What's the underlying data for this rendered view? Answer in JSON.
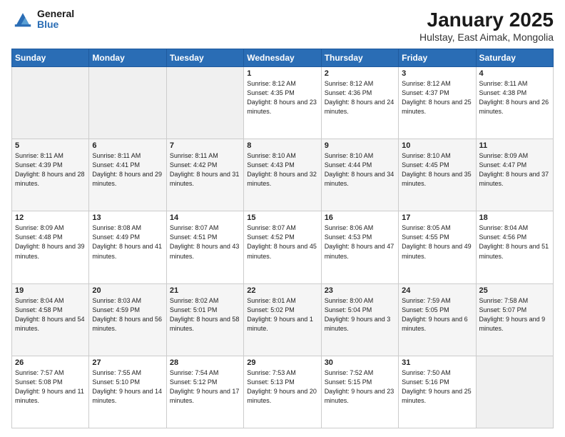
{
  "logo": {
    "general": "General",
    "blue": "Blue"
  },
  "header": {
    "title": "January 2025",
    "subtitle": "Hulstay, East Aimak, Mongolia"
  },
  "weekdays": [
    "Sunday",
    "Monday",
    "Tuesday",
    "Wednesday",
    "Thursday",
    "Friday",
    "Saturday"
  ],
  "weeks": [
    [
      {
        "day": "",
        "sunrise": "",
        "sunset": "",
        "daylight": ""
      },
      {
        "day": "",
        "sunrise": "",
        "sunset": "",
        "daylight": ""
      },
      {
        "day": "",
        "sunrise": "",
        "sunset": "",
        "daylight": ""
      },
      {
        "day": "1",
        "sunrise": "Sunrise: 8:12 AM",
        "sunset": "Sunset: 4:35 PM",
        "daylight": "Daylight: 8 hours and 23 minutes."
      },
      {
        "day": "2",
        "sunrise": "Sunrise: 8:12 AM",
        "sunset": "Sunset: 4:36 PM",
        "daylight": "Daylight: 8 hours and 24 minutes."
      },
      {
        "day": "3",
        "sunrise": "Sunrise: 8:12 AM",
        "sunset": "Sunset: 4:37 PM",
        "daylight": "Daylight: 8 hours and 25 minutes."
      },
      {
        "day": "4",
        "sunrise": "Sunrise: 8:11 AM",
        "sunset": "Sunset: 4:38 PM",
        "daylight": "Daylight: 8 hours and 26 minutes."
      }
    ],
    [
      {
        "day": "5",
        "sunrise": "Sunrise: 8:11 AM",
        "sunset": "Sunset: 4:39 PM",
        "daylight": "Daylight: 8 hours and 28 minutes."
      },
      {
        "day": "6",
        "sunrise": "Sunrise: 8:11 AM",
        "sunset": "Sunset: 4:41 PM",
        "daylight": "Daylight: 8 hours and 29 minutes."
      },
      {
        "day": "7",
        "sunrise": "Sunrise: 8:11 AM",
        "sunset": "Sunset: 4:42 PM",
        "daylight": "Daylight: 8 hours and 31 minutes."
      },
      {
        "day": "8",
        "sunrise": "Sunrise: 8:10 AM",
        "sunset": "Sunset: 4:43 PM",
        "daylight": "Daylight: 8 hours and 32 minutes."
      },
      {
        "day": "9",
        "sunrise": "Sunrise: 8:10 AM",
        "sunset": "Sunset: 4:44 PM",
        "daylight": "Daylight: 8 hours and 34 minutes."
      },
      {
        "day": "10",
        "sunrise": "Sunrise: 8:10 AM",
        "sunset": "Sunset: 4:45 PM",
        "daylight": "Daylight: 8 hours and 35 minutes."
      },
      {
        "day": "11",
        "sunrise": "Sunrise: 8:09 AM",
        "sunset": "Sunset: 4:47 PM",
        "daylight": "Daylight: 8 hours and 37 minutes."
      }
    ],
    [
      {
        "day": "12",
        "sunrise": "Sunrise: 8:09 AM",
        "sunset": "Sunset: 4:48 PM",
        "daylight": "Daylight: 8 hours and 39 minutes."
      },
      {
        "day": "13",
        "sunrise": "Sunrise: 8:08 AM",
        "sunset": "Sunset: 4:49 PM",
        "daylight": "Daylight: 8 hours and 41 minutes."
      },
      {
        "day": "14",
        "sunrise": "Sunrise: 8:07 AM",
        "sunset": "Sunset: 4:51 PM",
        "daylight": "Daylight: 8 hours and 43 minutes."
      },
      {
        "day": "15",
        "sunrise": "Sunrise: 8:07 AM",
        "sunset": "Sunset: 4:52 PM",
        "daylight": "Daylight: 8 hours and 45 minutes."
      },
      {
        "day": "16",
        "sunrise": "Sunrise: 8:06 AM",
        "sunset": "Sunset: 4:53 PM",
        "daylight": "Daylight: 8 hours and 47 minutes."
      },
      {
        "day": "17",
        "sunrise": "Sunrise: 8:05 AM",
        "sunset": "Sunset: 4:55 PM",
        "daylight": "Daylight: 8 hours and 49 minutes."
      },
      {
        "day": "18",
        "sunrise": "Sunrise: 8:04 AM",
        "sunset": "Sunset: 4:56 PM",
        "daylight": "Daylight: 8 hours and 51 minutes."
      }
    ],
    [
      {
        "day": "19",
        "sunrise": "Sunrise: 8:04 AM",
        "sunset": "Sunset: 4:58 PM",
        "daylight": "Daylight: 8 hours and 54 minutes."
      },
      {
        "day": "20",
        "sunrise": "Sunrise: 8:03 AM",
        "sunset": "Sunset: 4:59 PM",
        "daylight": "Daylight: 8 hours and 56 minutes."
      },
      {
        "day": "21",
        "sunrise": "Sunrise: 8:02 AM",
        "sunset": "Sunset: 5:01 PM",
        "daylight": "Daylight: 8 hours and 58 minutes."
      },
      {
        "day": "22",
        "sunrise": "Sunrise: 8:01 AM",
        "sunset": "Sunset: 5:02 PM",
        "daylight": "Daylight: 9 hours and 1 minute."
      },
      {
        "day": "23",
        "sunrise": "Sunrise: 8:00 AM",
        "sunset": "Sunset: 5:04 PM",
        "daylight": "Daylight: 9 hours and 3 minutes."
      },
      {
        "day": "24",
        "sunrise": "Sunrise: 7:59 AM",
        "sunset": "Sunset: 5:05 PM",
        "daylight": "Daylight: 9 hours and 6 minutes."
      },
      {
        "day": "25",
        "sunrise": "Sunrise: 7:58 AM",
        "sunset": "Sunset: 5:07 PM",
        "daylight": "Daylight: 9 hours and 9 minutes."
      }
    ],
    [
      {
        "day": "26",
        "sunrise": "Sunrise: 7:57 AM",
        "sunset": "Sunset: 5:08 PM",
        "daylight": "Daylight: 9 hours and 11 minutes."
      },
      {
        "day": "27",
        "sunrise": "Sunrise: 7:55 AM",
        "sunset": "Sunset: 5:10 PM",
        "daylight": "Daylight: 9 hours and 14 minutes."
      },
      {
        "day": "28",
        "sunrise": "Sunrise: 7:54 AM",
        "sunset": "Sunset: 5:12 PM",
        "daylight": "Daylight: 9 hours and 17 minutes."
      },
      {
        "day": "29",
        "sunrise": "Sunrise: 7:53 AM",
        "sunset": "Sunset: 5:13 PM",
        "daylight": "Daylight: 9 hours and 20 minutes."
      },
      {
        "day": "30",
        "sunrise": "Sunrise: 7:52 AM",
        "sunset": "Sunset: 5:15 PM",
        "daylight": "Daylight: 9 hours and 23 minutes."
      },
      {
        "day": "31",
        "sunrise": "Sunrise: 7:50 AM",
        "sunset": "Sunset: 5:16 PM",
        "daylight": "Daylight: 9 hours and 25 minutes."
      },
      {
        "day": "",
        "sunrise": "",
        "sunset": "",
        "daylight": ""
      }
    ]
  ]
}
